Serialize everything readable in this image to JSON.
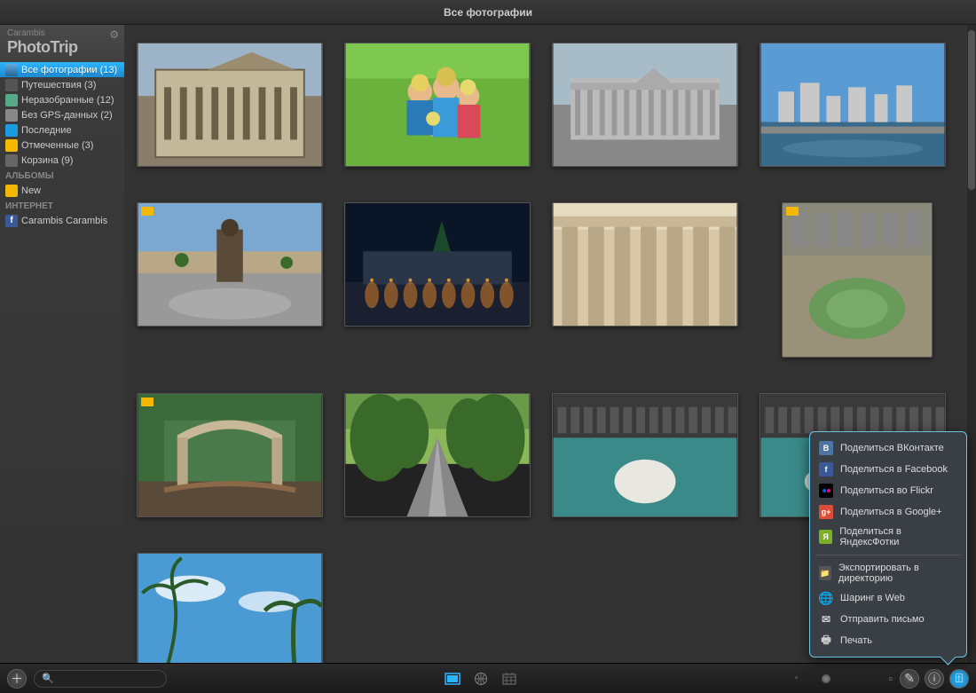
{
  "header": {
    "title": "Все фотографии"
  },
  "logo": {
    "supertitle": "Carambis",
    "title": "PhotoTrip"
  },
  "sidebar": {
    "items": [
      {
        "label": "Все фотографии (13)",
        "icon": "allphotos",
        "active": true
      },
      {
        "label": "Путешествия (3)",
        "icon": "travel"
      },
      {
        "label": "Неразобранные (12)",
        "icon": "unsorted"
      },
      {
        "label": "Без GPS-данных (2)",
        "icon": "nogps"
      },
      {
        "label": "Последние",
        "icon": "recent"
      },
      {
        "label": "Отмеченные (3)",
        "icon": "flagged"
      },
      {
        "label": "Корзина (9)",
        "icon": "trash"
      }
    ],
    "albums_header": "АЛЬБОМЫ",
    "albums": [
      {
        "label": "New",
        "icon": "album"
      }
    ],
    "internet_header": "ИНТЕРНЕТ",
    "internet": [
      {
        "label": "Carambis Carambis",
        "icon": "fb"
      }
    ]
  },
  "photos": [
    {
      "flagged": false,
      "kind": "building-classic"
    },
    {
      "flagged": false,
      "kind": "family-green"
    },
    {
      "flagged": false,
      "kind": "colonnade"
    },
    {
      "flagged": false,
      "kind": "river-city"
    },
    {
      "flagged": true,
      "kind": "statue-square"
    },
    {
      "flagged": false,
      "kind": "night-square"
    },
    {
      "flagged": false,
      "kind": "columns-close"
    },
    {
      "flagged": true,
      "kind": "aerial-park",
      "portrait": true
    },
    {
      "flagged": true,
      "kind": "garden-arch"
    },
    {
      "flagged": false,
      "kind": "tree-road"
    },
    {
      "flagged": false,
      "kind": "beluga-pool"
    },
    {
      "flagged": false,
      "kind": "beluga-pool2"
    },
    {
      "flagged": false,
      "kind": "palm-sky"
    }
  ],
  "sharemenu": {
    "items": [
      {
        "label": "Поделиться ВКонтакте",
        "icon": "vk",
        "letter": "B"
      },
      {
        "label": "Поделиться в Facebook",
        "icon": "fb2",
        "letter": "f"
      },
      {
        "label": "Поделиться во Flickr",
        "icon": "flickr",
        "letter": ""
      },
      {
        "label": "Поделиться в Google+",
        "icon": "gplus",
        "letter": "g+"
      },
      {
        "label": "Поделиться в ЯндексФотки",
        "icon": "yandex",
        "letter": "Я"
      }
    ],
    "items2": [
      {
        "label": "Экспортировать в директорию",
        "icon": "folder",
        "glyph": "📁"
      },
      {
        "label": "Шаринг в Web",
        "icon": "web",
        "glyph": "🌐"
      },
      {
        "label": "Отправить письмо",
        "icon": "mail",
        "glyph": "✉"
      },
      {
        "label": "Печать",
        "icon": "print",
        "glyph": "🖶"
      }
    ]
  },
  "bottombar": {
    "search_placeholder": "Q"
  }
}
